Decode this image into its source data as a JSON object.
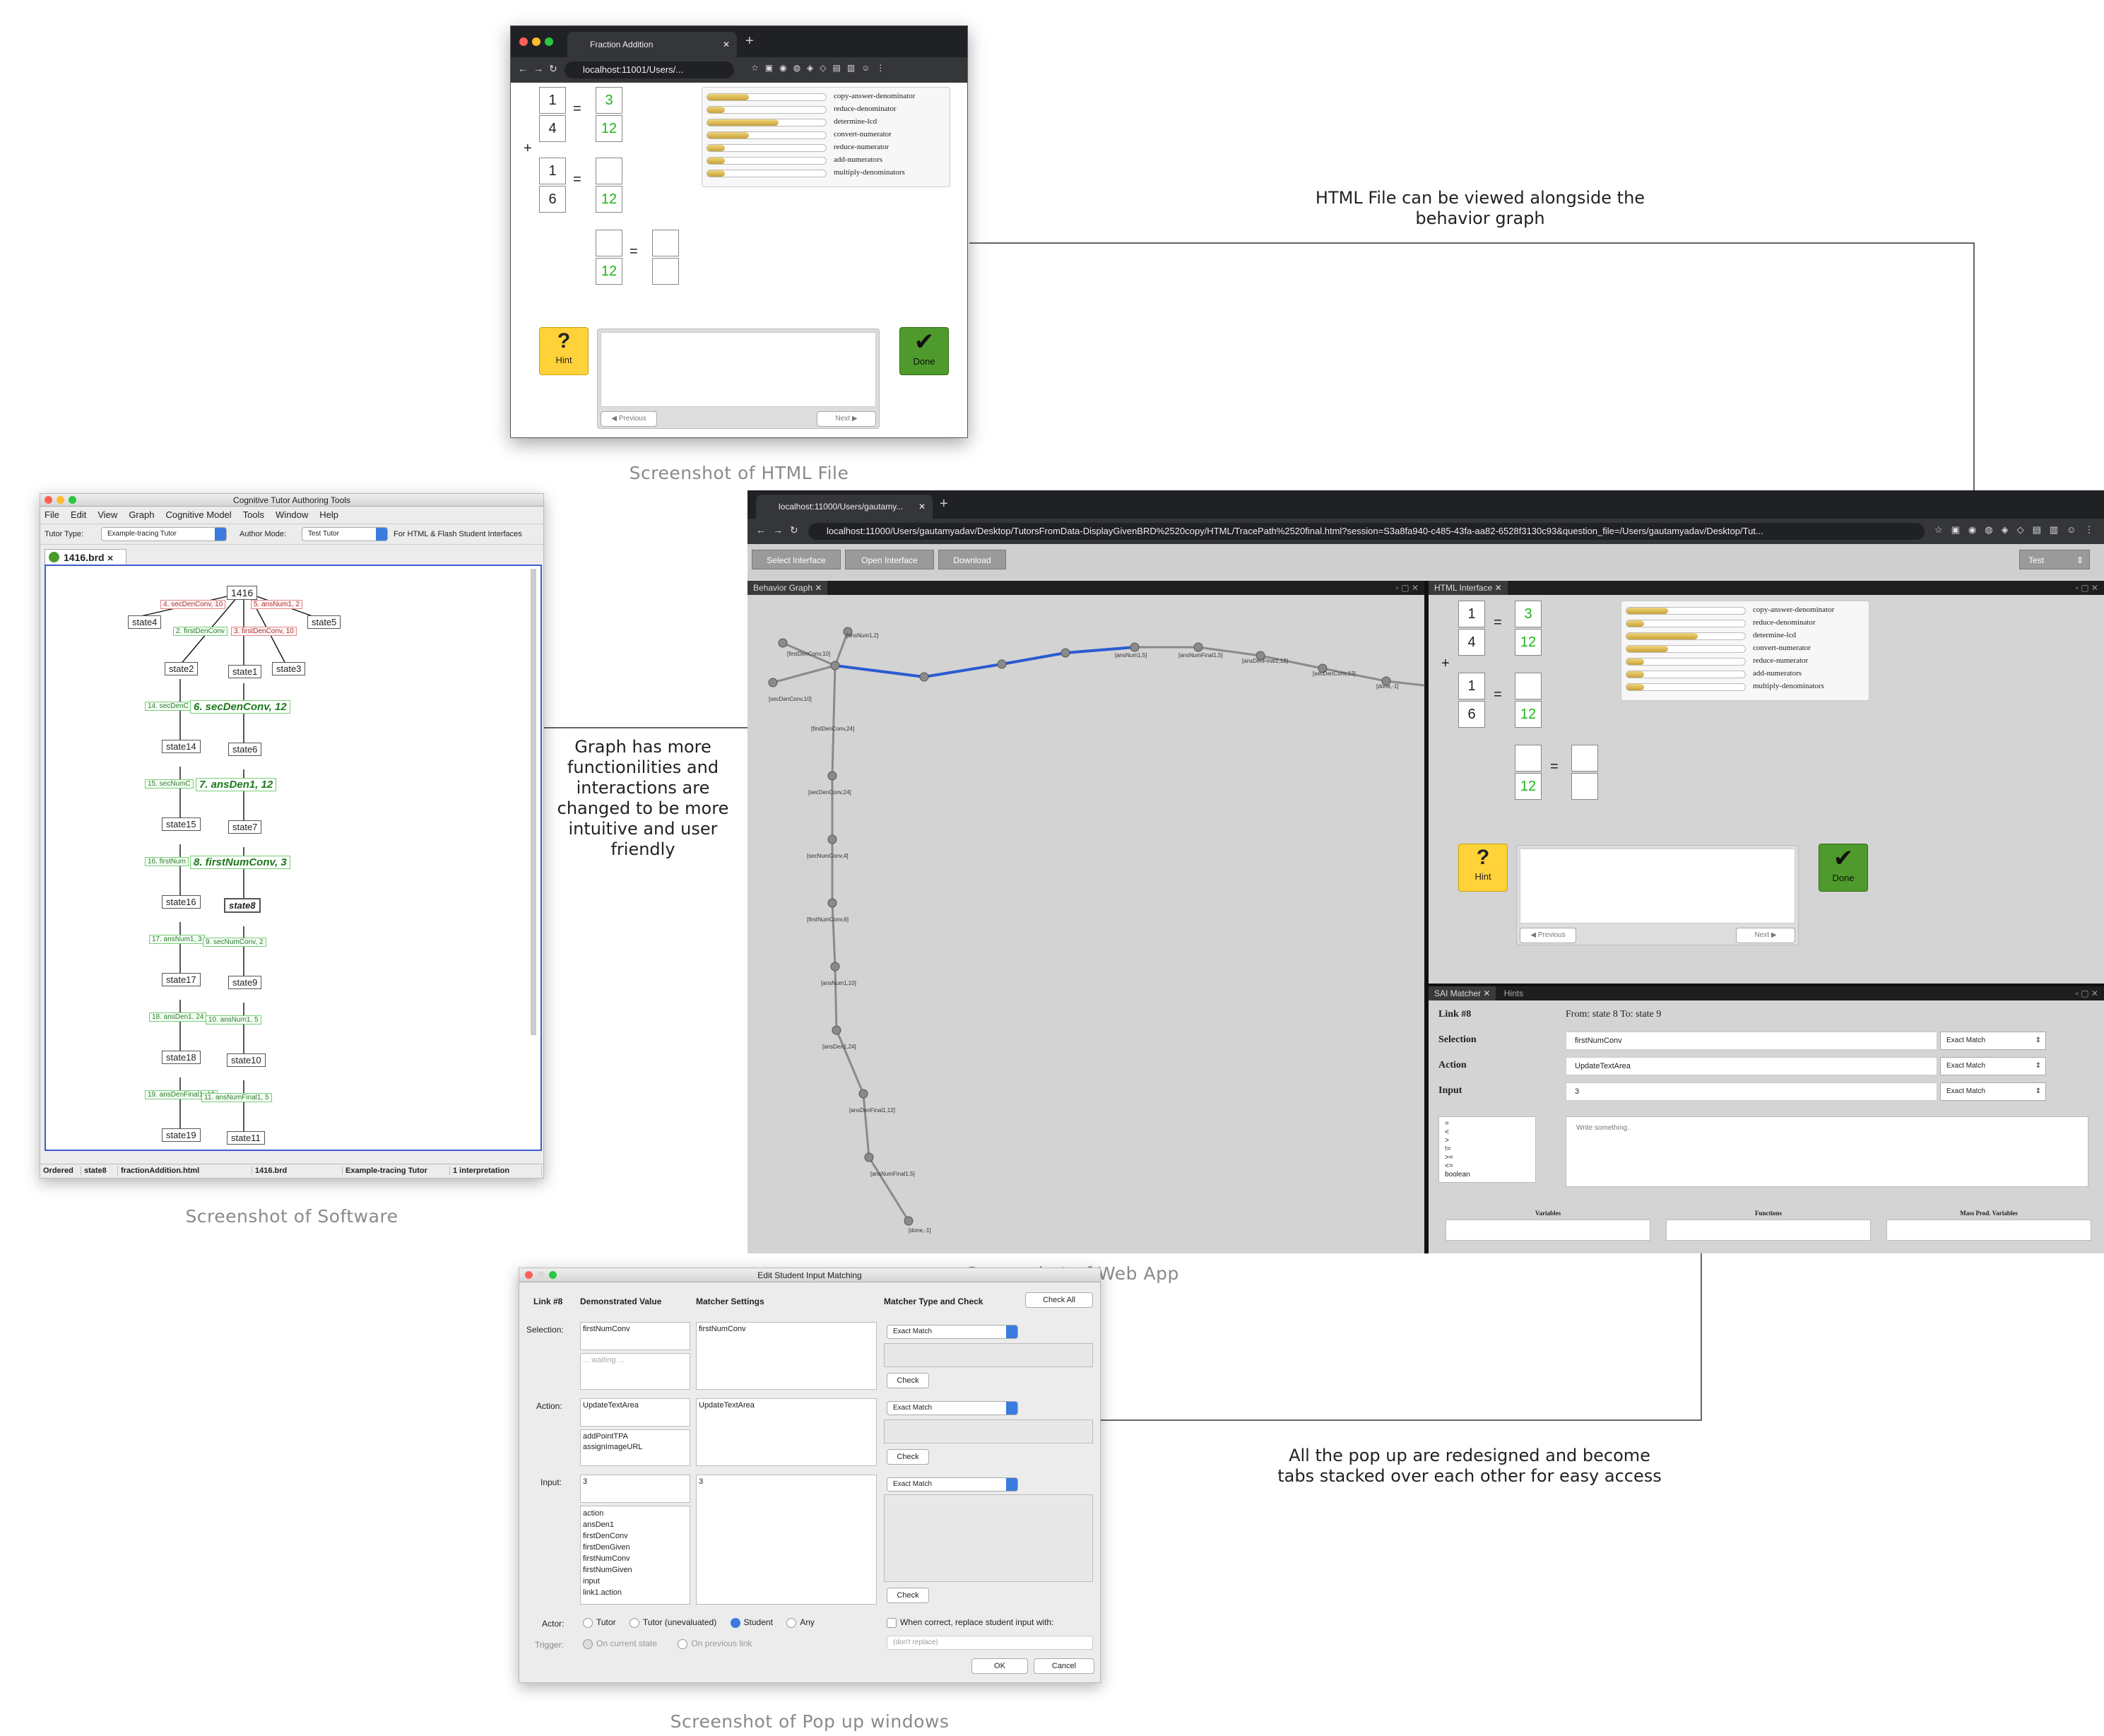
{
  "captions": {
    "html_file": "Screenshot of HTML File",
    "software": "Screenshot of Software",
    "web_app": "Screenshot of Web App",
    "popups": "Screenshot of Pop up windows"
  },
  "notes": {
    "html_view": "HTML File can be viewed alongside the behavior graph",
    "graph": "Graph has more functionilities and interactions are changed to be more intuitive and user friendly",
    "popups": "All the pop up are redesigned and become tabs  stacked over each other for easy access"
  },
  "html_window": {
    "tab_title": "Fraction Addition",
    "url": "localhost:11001/Users/...",
    "fractions": {
      "f1": [
        "1",
        "4"
      ],
      "r1": [
        "3",
        "12"
      ],
      "f2": [
        "1",
        "6"
      ],
      "r2": [
        "",
        "12"
      ],
      "sum": [
        "",
        "12"
      ],
      "ans": [
        "",
        ""
      ]
    },
    "ops": {
      "eq": "=",
      "plus": "+"
    },
    "skills": [
      {
        "label": "copy-answer-denominator",
        "level": 0.35
      },
      {
        "label": "reduce-denominator",
        "level": 0.15
      },
      {
        "label": "determine-lcd",
        "level": 0.6
      },
      {
        "label": "convert-numerator",
        "level": 0.35
      },
      {
        "label": "reduce-numerator",
        "level": 0.15
      },
      {
        "label": "add-numerators",
        "level": 0.15
      },
      {
        "label": "multiply-denominators",
        "level": 0.15
      }
    ],
    "hint": "Hint",
    "done": "Done",
    "previous": "Previous",
    "next": "Next"
  },
  "software": {
    "title": "Cognitive Tutor Authoring Tools",
    "menu": [
      "File",
      "Edit",
      "View",
      "Graph",
      "Cognitive Model",
      "Tools",
      "Window",
      "Help"
    ],
    "tutor_type_label": "Tutor Type:",
    "tutor_type": "Example-tracing Tutor",
    "author_mode_label": "Author Mode:",
    "author_mode": "Test Tutor",
    "for_label": "For HTML & Flash Student Interfaces",
    "tab": "1416.brd",
    "nodes": [
      "1416",
      "state4",
      "state5",
      "state2",
      "state1",
      "state3",
      "state14",
      "state6",
      "state15",
      "state7",
      "state16",
      "state8",
      "state17",
      "state9",
      "state18",
      "state10",
      "state19",
      "state11"
    ],
    "edges_red": [
      "4. secDenConv, 10",
      "5. ansNum1, 2",
      "3. firstDenConv, 10"
    ],
    "edges_green": [
      "2. firstDenConv",
      "14. secDenC",
      "15. secNumC",
      "16. firstNum",
      "17. ansNum1, 3",
      "9. secNumConv, 2",
      "18. ansDen1, 24",
      "10. ansNum1, 5",
      "19. ansDenFinal1, 12",
      "11. ansNumFinal1, 5"
    ],
    "edges_big": [
      "6. secDenConv, 12",
      "7. ansDen1, 12",
      "8. firstNumConv, 3"
    ],
    "status": [
      "Ordered",
      "state8",
      "fractionAddition.html",
      "1416.brd",
      "Example-tracing Tutor",
      "1 interpretation"
    ]
  },
  "webapp": {
    "tab_url": "localhost:11000/Users/gautamy...",
    "url": "localhost:11000/Users/gautamyadav/Desktop/TutorsFromData-DisplayGivenBRD%2520copy/HTML/TracePath%2520final.html?session=S3a8fa940-c485-43fa-aa82-6528f3130c93&question_file=/Users/gautamyadav/Desktop/Tut...",
    "buttons": [
      "Select Interface",
      "Open Interface",
      "Download"
    ],
    "mode": "Test",
    "graph_tab": "Behavior Graph",
    "html_tab": "HTML Interface",
    "sai_tab": "SAI Matcher",
    "hints_tab": "Hints",
    "graph_labels": [
      "[firstDenConv,10]",
      "[ansNum1,2]",
      "[secDenConv,10]",
      "[firstDenConv,24]",
      "[secDenConv,24]",
      "[secNumConv,4]",
      "[firstNumConv,6]",
      "[ansNum1,10]",
      "[ansDen1,24]",
      "[ansDenFinal1,12]",
      "[ansNumFinal1,5]",
      "[done,-1]",
      "[ansNum1,5]",
      "[ansNumFinal1,5]",
      "[ansDenFinal1,12]",
      "[secDenConv,12]",
      "[done,-1]"
    ],
    "sai": {
      "link": "Link #8",
      "from": "From: state 8 To: state 9",
      "rows": [
        {
          "label": "Selection",
          "value": "firstNumConv",
          "match": "Exact Match"
        },
        {
          "label": "Action",
          "value": "UpdateTextArea",
          "match": "Exact Match"
        },
        {
          "label": "Input",
          "value": "3",
          "match": "Exact Match"
        }
      ],
      "ops": [
        "=",
        "<",
        ">",
        "!=",
        ">=",
        "<=",
        "boolean"
      ],
      "placeholder": "Write something..",
      "cols": [
        "Variables",
        "Functions",
        "Mass Prod. Variables"
      ]
    }
  },
  "popup": {
    "title": "Edit Student Input Matching",
    "link": "Link #8",
    "h_demo": "Demonstrated Value",
    "h_matcher": "Matcher Settings",
    "h_type": "Matcher Type and Check",
    "check_all": "Check All",
    "selection_label": "Selection:",
    "action_label": "Action:",
    "input_label": "Input:",
    "sel_demo": "firstNumConv",
    "sel_waiting": "... waiting ...",
    "sel_matcher": "firstNumConv",
    "sel_type": "Exact Match",
    "act_demo": "UpdateTextArea",
    "act_list": [
      "addPointTPA",
      "assignImageURL"
    ],
    "act_matcher": "UpdateTextArea",
    "act_type": "Exact Match",
    "inp_demo": "3",
    "inp_list": [
      "action",
      "ansDen1",
      "firstDenConv",
      "firstDenGiven",
      "firstNumConv",
      "firstNumGiven",
      "input",
      "link1.action"
    ],
    "inp_matcher": "3",
    "inp_type": "Exact Match",
    "check": "Check",
    "actor_label": "Actor:",
    "actors": [
      "Tutor",
      "Tutor (unevaluated)",
      "Student",
      "Any"
    ],
    "replace": "When correct, replace student input with:",
    "dont_replace": "(don't replace)",
    "trigger_label": "Trigger:",
    "triggers": [
      "On current state",
      "On previous link"
    ],
    "ok": "OK",
    "cancel": "Cancel"
  }
}
